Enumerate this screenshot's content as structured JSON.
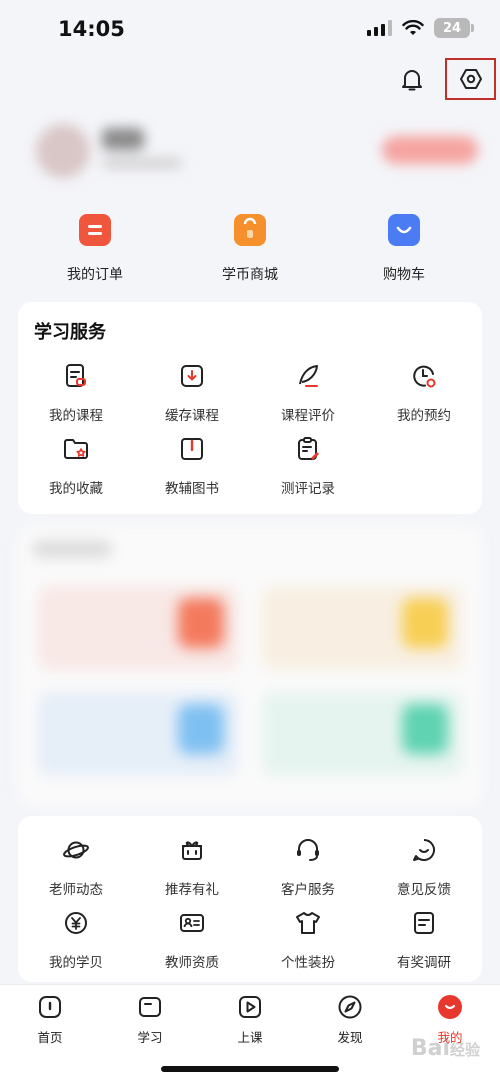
{
  "status": {
    "time": "14:05",
    "battery": "24"
  },
  "quick_links": [
    {
      "label": "我的订单",
      "icon": "order-icon",
      "color": "#f0563c"
    },
    {
      "label": "学币商城",
      "icon": "mall-bag-icon",
      "color": "#f5902c"
    },
    {
      "label": "购物车",
      "icon": "cart-icon",
      "color": "#4b7cf3"
    }
  ],
  "study_service": {
    "title": "学习服务",
    "items": [
      {
        "label": "我的课程",
        "icon": "course-icon"
      },
      {
        "label": "缓存课程",
        "icon": "download-icon"
      },
      {
        "label": "课程评价",
        "icon": "feather-icon"
      },
      {
        "label": "我的预约",
        "icon": "clock-icon"
      },
      {
        "label": "我的收藏",
        "icon": "folder-star-icon"
      },
      {
        "label": "教辅图书",
        "icon": "book-icon"
      },
      {
        "label": "测评记录",
        "icon": "clipboard-icon"
      }
    ]
  },
  "more_services": {
    "items": [
      {
        "label": "老师动态",
        "icon": "planet-icon"
      },
      {
        "label": "推荐有礼",
        "icon": "gift-icon"
      },
      {
        "label": "客户服务",
        "icon": "headset-icon"
      },
      {
        "label": "意见反馈",
        "icon": "chat-smile-icon"
      },
      {
        "label": "我的学贝",
        "icon": "coin-icon"
      },
      {
        "label": "教师资质",
        "icon": "id-card-icon"
      },
      {
        "label": "个性装扮",
        "icon": "tshirt-icon"
      },
      {
        "label": "有奖调研",
        "icon": "survey-icon"
      }
    ]
  },
  "tabbar": {
    "items": [
      {
        "label": "首页",
        "icon": "home-icon"
      },
      {
        "label": "学习",
        "icon": "study-icon"
      },
      {
        "label": "上课",
        "icon": "play-icon"
      },
      {
        "label": "发现",
        "icon": "compass-icon"
      },
      {
        "label": "我的",
        "icon": "profile-icon"
      }
    ],
    "active_color": "#e8372c"
  },
  "watermark": {
    "text": "Bai",
    "sub": "经验"
  }
}
